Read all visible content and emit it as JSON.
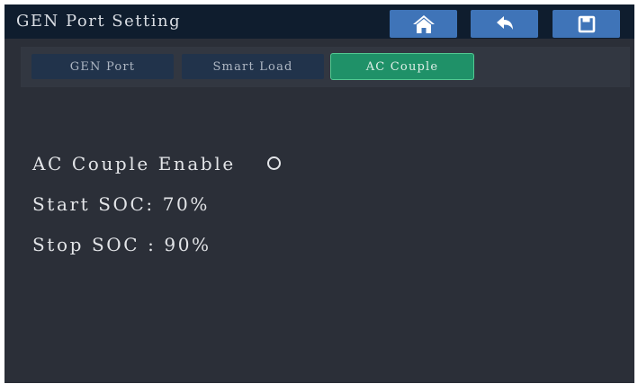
{
  "header": {
    "title": "GEN Port Setting",
    "buttons": [
      {
        "name": "home",
        "icon": "home-icon"
      },
      {
        "name": "back",
        "icon": "back-arrow-icon"
      },
      {
        "name": "save",
        "icon": "save-icon"
      }
    ]
  },
  "tabs": [
    {
      "label": "GEN Port",
      "active": false
    },
    {
      "label": "Smart Load",
      "active": false
    },
    {
      "label": "AC Couple",
      "active": true
    }
  ],
  "settings": {
    "ac_couple_enable": {
      "label": "AC Couple Enable",
      "checked": false
    },
    "start_soc": {
      "text": "Start SOC: 70%"
    },
    "stop_soc": {
      "text": "Stop SOC : 90%"
    }
  },
  "colors": {
    "background": "#2b2f38",
    "header": "#0f1d2e",
    "button": "#3f74b8",
    "tab_inactive": "#21334b",
    "tab_active": "#1f9168"
  }
}
